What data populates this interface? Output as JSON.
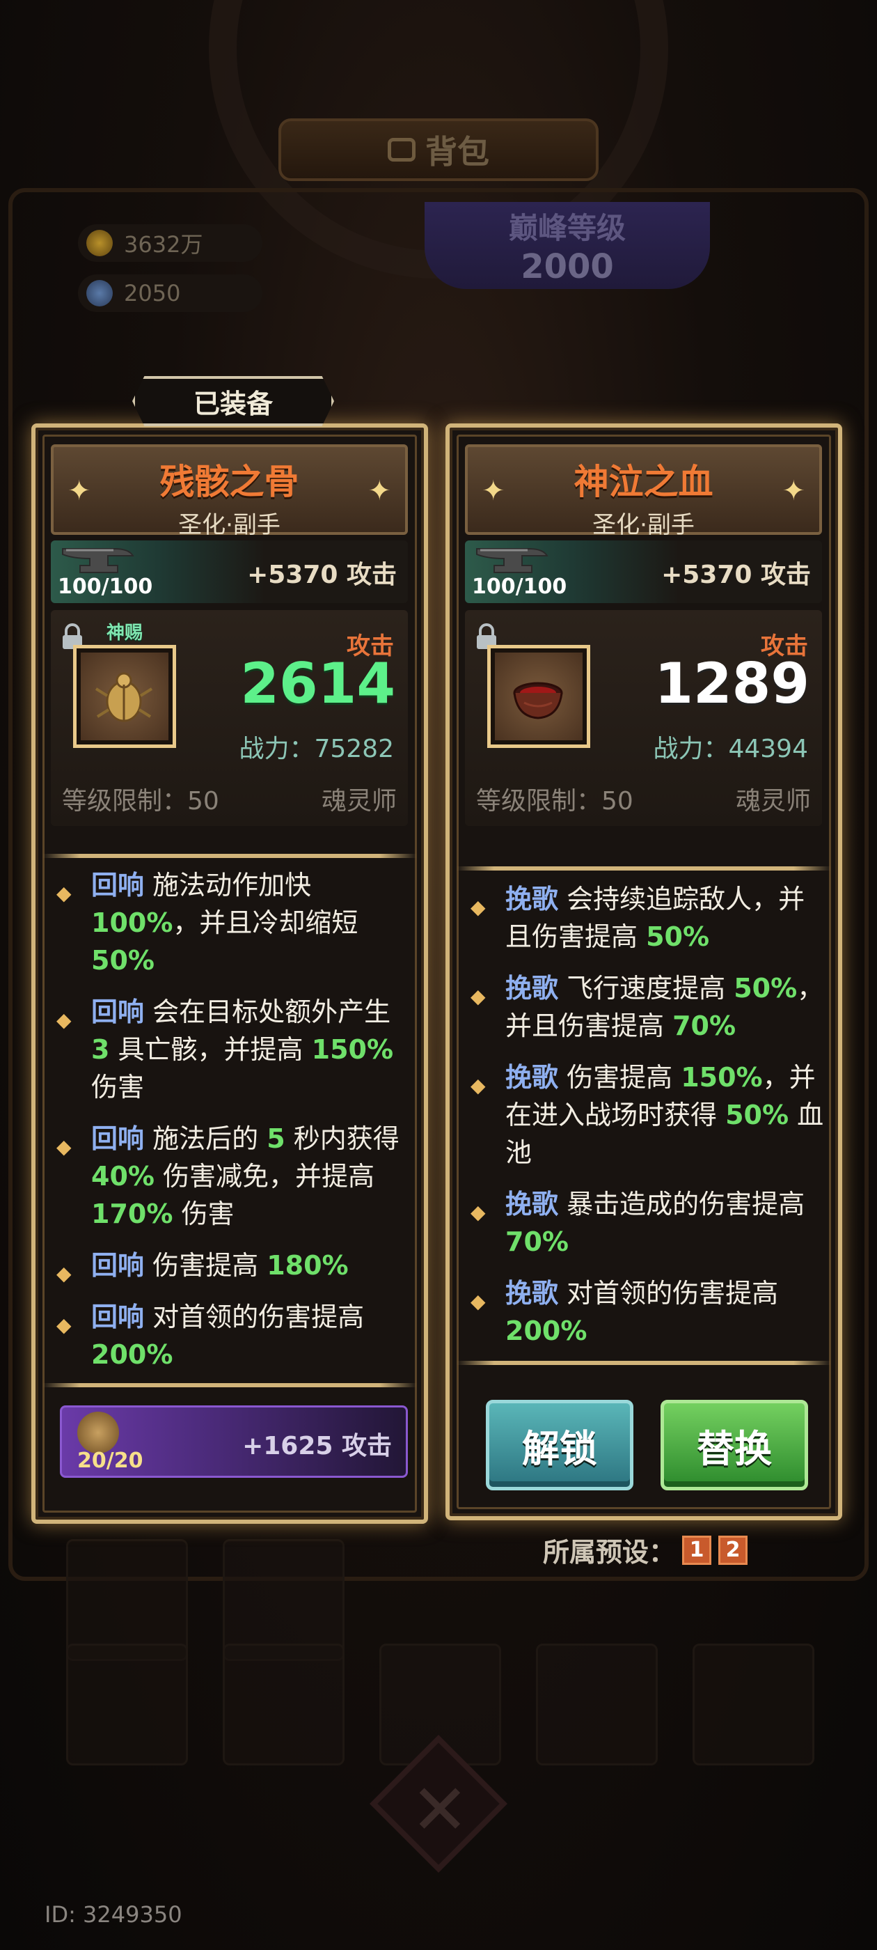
{
  "header": {
    "title": "背包"
  },
  "currencies": [
    {
      "icon": "gold-coin-icon",
      "value": "3632万"
    },
    {
      "icon": "gem-icon",
      "value": "2050"
    }
  ],
  "peak": {
    "title": "巅峰等级",
    "level": "2000"
  },
  "equipped_tab": "已装备",
  "cards": [
    {
      "name": "残骸之骨",
      "type": "圣化·副手",
      "forge_count": "100/100",
      "forge_bonus": "+5370 攻击",
      "gift_tag": "神赐",
      "attack_label": "攻击",
      "attack_value": "2614",
      "power": "战力：75282",
      "level_req": "等级限制：50",
      "class": "魂灵师",
      "affixes": [
        {
          "tag": "回响",
          "parts": [
            "施法动作加快 ",
            "100%",
            "，并且冷却缩短 ",
            "50%"
          ]
        },
        {
          "tag": "回响",
          "parts": [
            "会在目标处额外产生 ",
            "3",
            " 具亡骸，并提高 ",
            "150%",
            " 伤害"
          ]
        },
        {
          "tag": "回响",
          "parts": [
            "施法后的 ",
            "5",
            " 秒内获得 ",
            "40%",
            " 伤害减免，并提高 ",
            "170%",
            " 伤害"
          ]
        },
        {
          "tag": "回响",
          "parts": [
            "伤害提高 ",
            "180%"
          ]
        },
        {
          "tag": "回响",
          "parts": [
            "对首领的伤害提高 ",
            "200%"
          ]
        }
      ],
      "soul_count": "20/20",
      "soul_bonus": "+1625 攻击"
    },
    {
      "name": "神泣之血",
      "type": "圣化·副手",
      "forge_count": "100/100",
      "forge_bonus": "+5370 攻击",
      "attack_label": "攻击",
      "attack_value": "1289",
      "power": "战力：44394",
      "level_req": "等级限制：50",
      "class": "魂灵师",
      "affixes": [
        {
          "tag": "挽歌",
          "parts": [
            "会持续追踪敌人，并且伤害提高 ",
            "50%"
          ]
        },
        {
          "tag": "挽歌",
          "parts": [
            "飞行速度提高 ",
            "50%",
            "，并且伤害提高 ",
            "70%"
          ]
        },
        {
          "tag": "挽歌",
          "parts": [
            "伤害提高 ",
            "150%",
            "，并在进入战场时获得 ",
            "50%",
            " 血池"
          ]
        },
        {
          "tag": "挽歌",
          "parts": [
            "暴击造成的伤害提高 ",
            "70%"
          ]
        },
        {
          "tag": "挽歌",
          "parts": [
            "对首领的伤害提高 ",
            "200%"
          ]
        }
      ],
      "buttons": {
        "unlock": "解锁",
        "replace": "替换"
      }
    }
  ],
  "preset": {
    "label": "所属预设：",
    "values": [
      "1",
      "2"
    ]
  },
  "footer_id": "ID: 3249350",
  "colors": {
    "accent_gold": "#d1b47a",
    "value_green": "#6fe06a",
    "tag_blue": "#8fb0f0",
    "name_orange": "#f07a35"
  }
}
